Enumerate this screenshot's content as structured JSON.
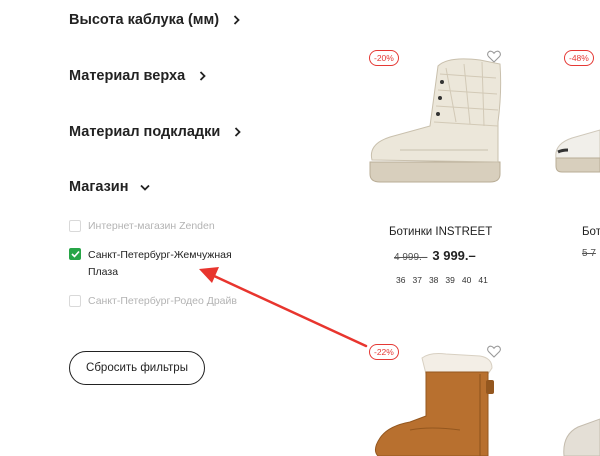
{
  "filters": {
    "heel_height": "Высота каблука (мм)",
    "upper_material": "Материал верха",
    "lining_material": "Материал подкладки",
    "store": "Магазин"
  },
  "store_options": [
    {
      "label": "Интернет-магазин Zenden",
      "checked": false
    },
    {
      "label": "Санкт-Петербург-Жемчужная Плаза",
      "checked": true
    },
    {
      "label": "Санкт-Петербург-Родео Драйв",
      "checked": false
    }
  ],
  "reset_button": "Сбросить фильтры",
  "products": [
    {
      "badge": "-20%",
      "name": "Ботинки INSTREET",
      "old_price": "4 999.–",
      "price": "3 999.–",
      "sizes": [
        "36",
        "37",
        "38",
        "39",
        "40",
        "41"
      ]
    },
    {
      "badge": "-48%",
      "name": "Бот",
      "old_price": "5 7"
    },
    {
      "badge": "-22%"
    }
  ],
  "colors": {
    "accent_red": "#e53935",
    "check_green": "#27a547",
    "arrow_red": "#e8352e"
  }
}
